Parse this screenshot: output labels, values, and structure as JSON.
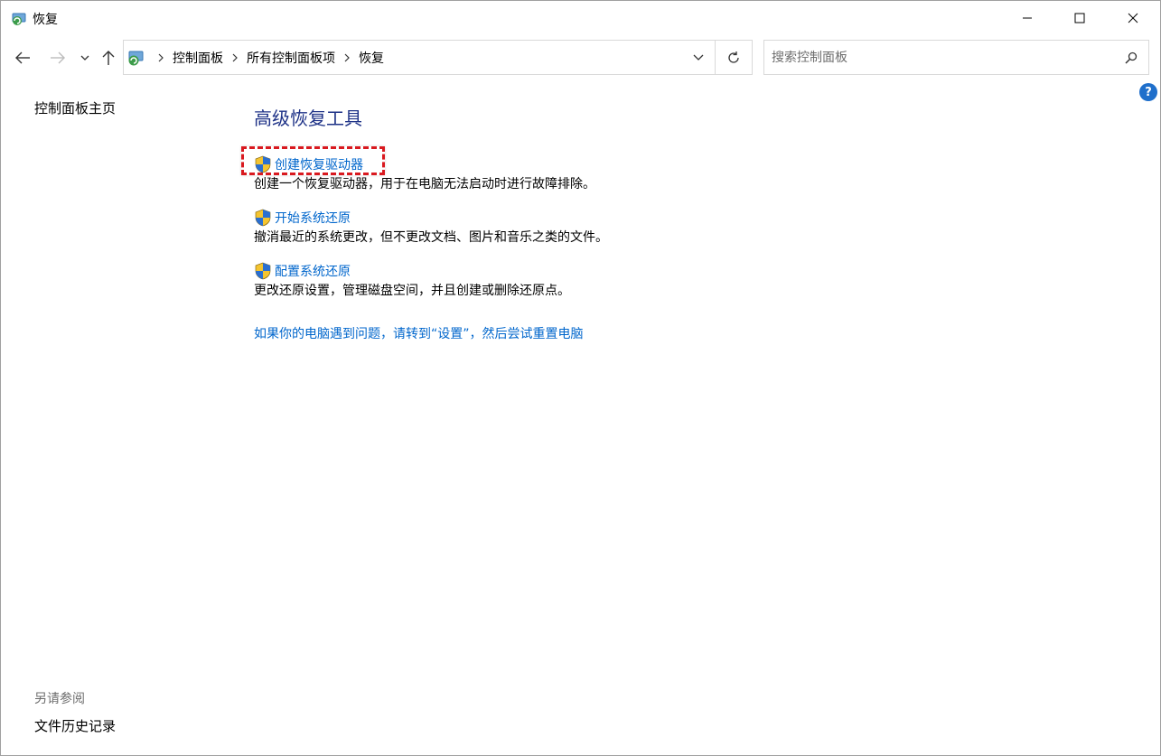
{
  "window": {
    "title": "恢复"
  },
  "address": {
    "crumbs": [
      "控制面板",
      "所有控制面板项",
      "恢复"
    ]
  },
  "search": {
    "placeholder": "搜索控制面板"
  },
  "help": {
    "label": "?"
  },
  "left_nav": {
    "home": "控制面板主页",
    "see_also": "另请参阅",
    "file_history": "文件历史记录"
  },
  "main": {
    "title": "高级恢复工具",
    "tasks": [
      {
        "link": "创建恢复驱动器",
        "desc": "创建一个恢复驱动器，用于在电脑无法启动时进行故障排除。"
      },
      {
        "link": "开始系统还原",
        "desc": "撤消最近的系统更改，但不更改文档、图片和音乐之类的文件。"
      },
      {
        "link": "配置系统还原",
        "desc": "更改还原设置，管理磁盘空间，并且创建或删除还原点。"
      }
    ],
    "settings_link": "如果你的电脑遇到问题，请转到“设置”，然后尝试重置电脑"
  },
  "icons": {
    "title": "recovery-icon",
    "shield": "uac-shield-icon"
  },
  "colors": {
    "link": "#0066cc",
    "title": "#1e3287",
    "highlight": "#d9191f"
  }
}
